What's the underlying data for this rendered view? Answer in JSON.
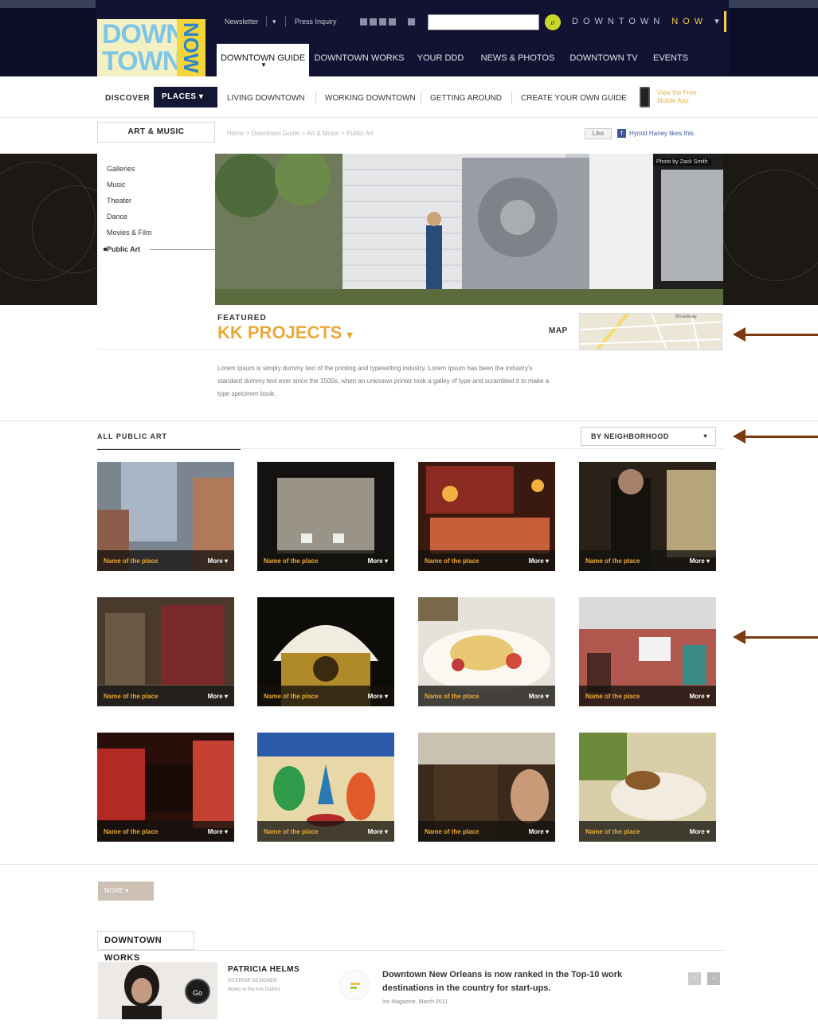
{
  "header": {
    "logo": {
      "line1": "DOWN",
      "line2": "TOWN",
      "side": "NOW"
    },
    "utility": {
      "newsletter": "Newsletter",
      "press": "Press Inquiry"
    },
    "search": {
      "placeholder": ""
    },
    "city_selector": {
      "prefix": "DOWNTOWN",
      "suffix": "NOW"
    },
    "main_nav": [
      {
        "label": "DOWNTOWN GUIDE",
        "active": true
      },
      {
        "label": "DOWNTOWN WORKS"
      },
      {
        "label": "YOUR DDD"
      },
      {
        "label": "NEWS & PHOTOS"
      },
      {
        "label": "DOWNTOWN TV"
      },
      {
        "label": "EVENTS"
      }
    ]
  },
  "subnav": {
    "discover": "DISCOVER",
    "places": "PLACES",
    "items": [
      "LIVING DOWNTOWN",
      "WORKING DOWNTOWN",
      "GETTING AROUND",
      "CREATE YOUR OWN GUIDE"
    ],
    "mobile_text": "View the Free Mobile App"
  },
  "category": {
    "title": "ART & MUSIC",
    "breadcrumb": "Home  >  Downtown Guide  >  Art & Music  >  Public Art",
    "like_label": "Like",
    "fb_text": "Hymid Haney likes this."
  },
  "sidemenu": [
    "Galleries",
    "Music",
    "Theater",
    "Dance",
    "Movies & Film",
    "Public Art"
  ],
  "hero": {
    "photo_credit": "Photo by Zack Smith"
  },
  "featured": {
    "label": "FEATURED",
    "title": "KK PROJECTS",
    "map_label": "MAP",
    "map_street": "Broadway",
    "description": "Lorem Ipsum is simply dummy text of the printing and typesetting industry. Lorem Ipsum has been the industry's standard dummy text ever since the 1500s, when an unknown printer took a galley of type and scrambled it to make a type specimen book."
  },
  "grid": {
    "title": "ALL PUBLIC ART",
    "filter": "BY NEIGHBORHOOD",
    "tiles": [
      {
        "name": "Name of the place",
        "more": "More"
      },
      {
        "name": "Name of the place",
        "more": "More"
      },
      {
        "name": "Name of the place",
        "more": "More"
      },
      {
        "name": "Name of the place",
        "more": "More"
      },
      {
        "name": "Name of the place",
        "more": "More"
      },
      {
        "name": "Name of the place",
        "more": "More"
      },
      {
        "name": "Name of the place",
        "more": "More"
      },
      {
        "name": "Name of the place",
        "more": "More"
      },
      {
        "name": "Name of the place",
        "more": "More"
      },
      {
        "name": "Name of the place",
        "more": "More"
      },
      {
        "name": "Name of the place",
        "more": "More"
      },
      {
        "name": "Name of the place",
        "more": "More"
      }
    ],
    "more_button": "MORE"
  },
  "downtown_works": {
    "title": "DOWNTOWN WORKS",
    "go": "Go",
    "person_name": "PATRICIA HELMS",
    "person_role": "INTERIOR DESIGNER",
    "person_note": "Works in the Arts District",
    "news_headline": "Downtown New Orleans is now ranked in the Top-10 work destinations in the country for start-ups.",
    "news_source": "Inc Magazine, March 2011"
  },
  "colors": {
    "accent": "#e9a93b",
    "navy": "#121332",
    "arrow": "#7b3a10"
  }
}
